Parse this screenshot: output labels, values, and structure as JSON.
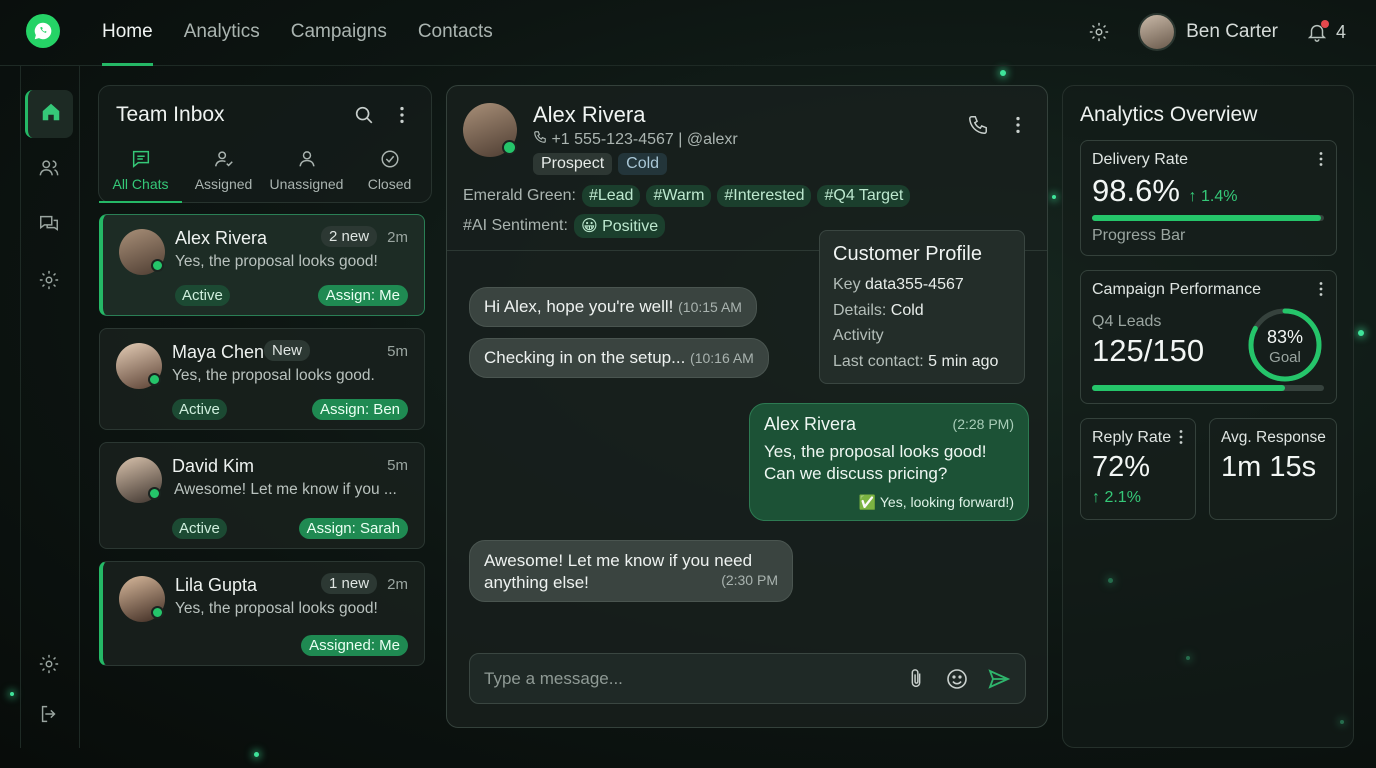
{
  "topbar": {
    "nav": [
      "Home",
      "Analytics",
      "Campaigns",
      "Contacts"
    ],
    "user_name": "Ben Carter",
    "notification_count": "4"
  },
  "inbox": {
    "title": "Team Inbox",
    "tabs": [
      "All Chats",
      "Assigned",
      "Unassigned",
      "Closed"
    ],
    "chats": [
      {
        "name": "Alex Rivera",
        "badge": "2 new",
        "time": "2m",
        "preview": "Yes, the proposal looks good!",
        "status": "Active",
        "assign": "Assign: Me"
      },
      {
        "name": "Maya Chen",
        "badge": "New",
        "time": "5m",
        "preview": "Yes, the proposal looks good.",
        "status": "Active",
        "assign": "Assign: Ben"
      },
      {
        "name": "David Kim",
        "badge": "",
        "time": "5m",
        "preview": "Awesome! Let me know if you ...",
        "status": "Active",
        "assign": "Assign: Sarah"
      },
      {
        "name": "Lila Gupta",
        "badge": "1 new",
        "time": "2m",
        "preview": "Yes, the proposal looks good!",
        "status": "",
        "assign": "Assigned: Me"
      }
    ]
  },
  "conversation": {
    "name": "Alex Rivera",
    "phone": "+1 555-123-4567 | @alexr",
    "tags": [
      "Prospect",
      "Cold"
    ],
    "label_row_title": "Emerald Green:",
    "label_tags": [
      "#Lead",
      "#Warm",
      "#Interested",
      "#Q4 Target"
    ],
    "sentiment_title": "#AI Sentiment:",
    "sentiment_value": "😀 Positive",
    "messages": [
      {
        "text": "Hi Alex, hope you're well!",
        "time": "(10:15 AM"
      },
      {
        "text": "Checking in on the setup...",
        "time": "(10:16 AM"
      },
      {
        "sender": "Alex Rivera",
        "time": "(2:28 PM)",
        "line1": "Yes, the proposal looks good!",
        "line2": "Can we discuss pricing?",
        "reaction": "✅ Yes, looking forward!)"
      },
      {
        "line1": "Awesome! Let me know if you need",
        "line2": "anything else!",
        "time": "(2:30 PM"
      }
    ],
    "composer_placeholder": "Type a message..."
  },
  "profile": {
    "title": "Customer Profile",
    "key_label": "Key ",
    "key_value": "data355-4567",
    "details_label": "Details: ",
    "details_value": "Cold",
    "activity_label": "Activity",
    "last_contact_label": "Last contact: ",
    "last_contact_value": "5 min ago"
  },
  "analytics": {
    "title": "Analytics Overview",
    "delivery": {
      "label": "Delivery Rate",
      "value": "98.6%",
      "delta": "↑ 1.4%",
      "bar_label": "Progress Bar",
      "fill": 0.986
    },
    "campaign": {
      "label": "Campaign Performance",
      "sub": "Q4 Leads",
      "value": "125/150",
      "ring_value": "83%",
      "ring_label": "Goal",
      "fill": 0.83
    },
    "reply": {
      "label": "Reply Rate",
      "value": "72%",
      "delta": "↑ 2.1%"
    },
    "response": {
      "label": "Avg. Response",
      "value": "1m 15s"
    }
  },
  "colors": {
    "accent": "#25b866",
    "bg": "#0d1512",
    "bubble_out": "#1c5236"
  }
}
